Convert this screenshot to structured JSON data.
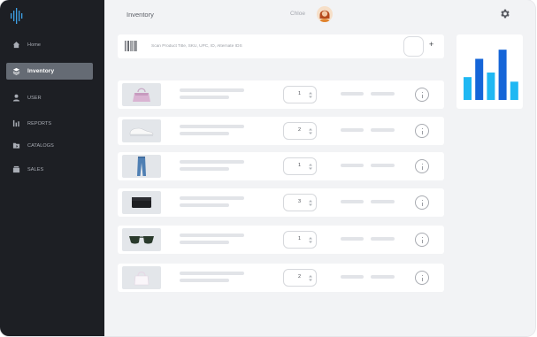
{
  "app": {
    "title": "Inventory",
    "user_name": "Chloe"
  },
  "sidebar": {
    "items": [
      {
        "label": "Home",
        "icon": "home-icon"
      },
      {
        "label": "Inventory",
        "icon": "layers-icon",
        "active": true
      },
      {
        "label": "USER",
        "icon": "user-icon"
      },
      {
        "label": "REPORTS",
        "icon": "bar-chart-icon"
      },
      {
        "label": "CATALOGS",
        "icon": "folder-icon"
      },
      {
        "label": "SALES",
        "icon": "register-icon"
      }
    ]
  },
  "search": {
    "placeholder": "Scan Product Title, SKU, UPC, ID, Alternate IDS",
    "add_label": "+"
  },
  "items": [
    {
      "product": "pink-handbag",
      "qty": "1"
    },
    {
      "product": "white-sneaker",
      "qty": "2"
    },
    {
      "product": "blue-jeans",
      "qty": "1"
    },
    {
      "product": "black-clutch",
      "qty": "3"
    },
    {
      "product": "sunglasses",
      "qty": "1"
    },
    {
      "product": "white-tote-bag",
      "qty": "2"
    }
  ],
  "chart_data": {
    "type": "bar",
    "values": [
      5,
      9,
      6,
      11,
      4
    ],
    "ylim": [
      0,
      12
    ],
    "colors": [
      "#1fb8f3",
      "#1565d8",
      "#1fb8f3",
      "#1565d8",
      "#1fb8f3"
    ]
  },
  "colors": {
    "sidebar_bg": "#1d1f24",
    "active_nav": "#656b74",
    "chart_light": "#1fb8f3",
    "chart_dark": "#1565d8"
  }
}
